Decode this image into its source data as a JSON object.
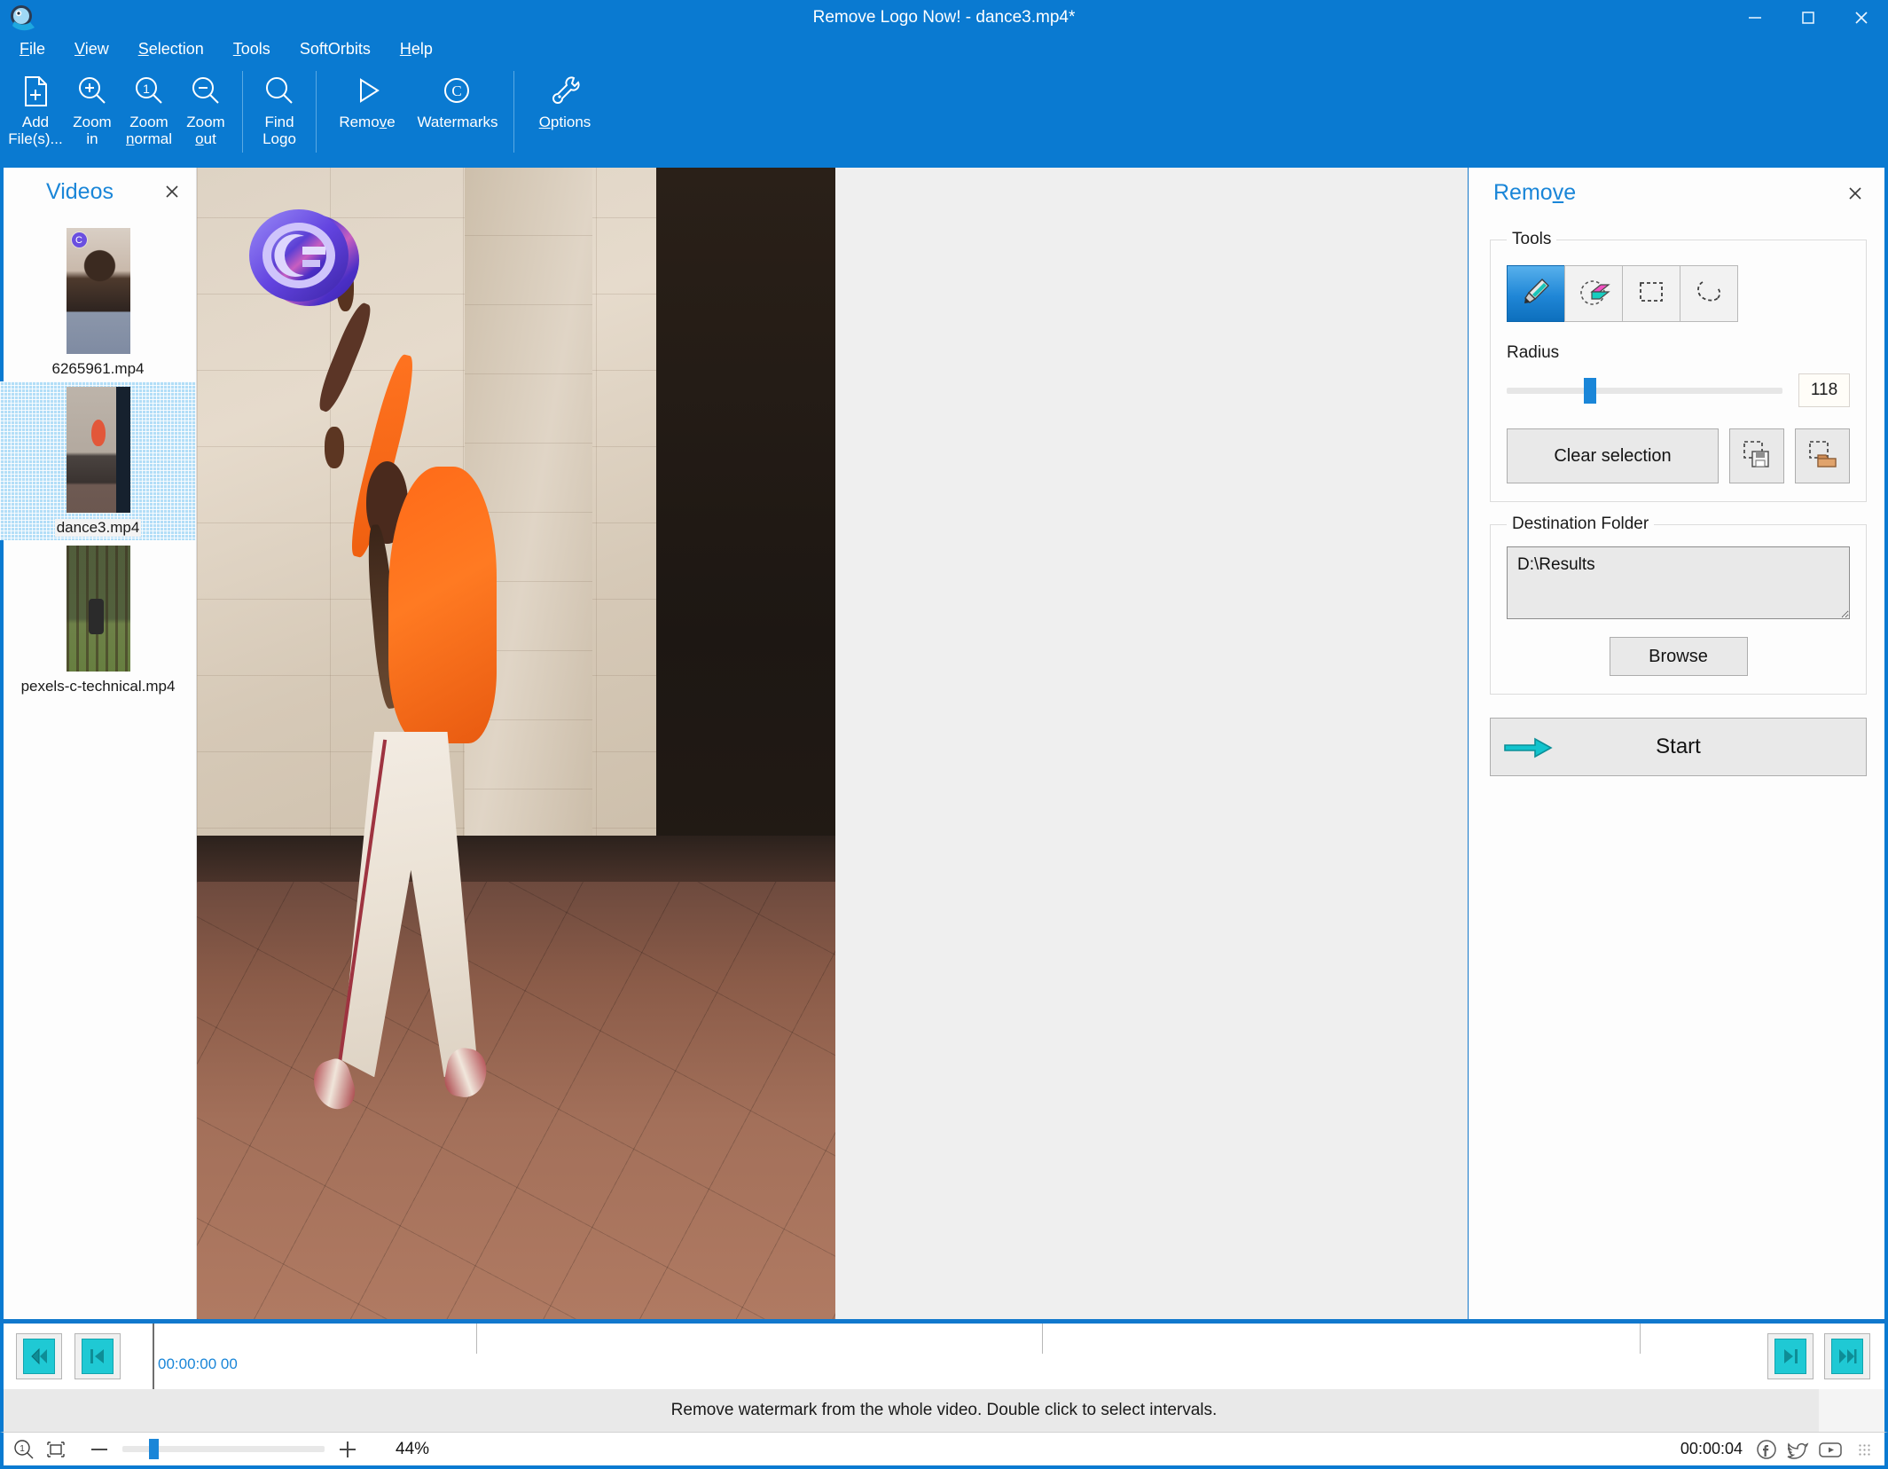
{
  "window": {
    "title": "Remove Logo Now! - dance3.mp4*",
    "app_icon": "app-logo-icon",
    "minimize": "minimize-icon",
    "maximize": "maximize-icon",
    "close": "close-icon",
    "titlebar_color": "#0a7ad1"
  },
  "menubar": {
    "items": [
      {
        "label": "File",
        "accel": "F"
      },
      {
        "label": "View",
        "accel": "V"
      },
      {
        "label": "Selection",
        "accel": "S"
      },
      {
        "label": "Tools",
        "accel": "T"
      },
      {
        "label": "SoftOrbits",
        "accel": ""
      },
      {
        "label": "Help",
        "accel": "H"
      }
    ]
  },
  "ribbon": {
    "items": [
      {
        "label_line1": "Add",
        "label_line2": "File(s)...",
        "icon": "add-file-icon"
      },
      {
        "label_line1": "Zoom",
        "label_line2": "in",
        "icon": "zoom-in-icon"
      },
      {
        "label_line1": "Zoom",
        "label_line2": "normal",
        "icon": "zoom-normal-icon"
      },
      {
        "label_line1": "Zoom",
        "label_line2": "out",
        "icon": "zoom-out-icon"
      },
      {
        "label_line1": "Find",
        "label_line2": "Logo",
        "icon": "find-logo-icon"
      },
      {
        "label_line1": "Remove",
        "label_line2": "",
        "icon": "play-triangle-icon"
      },
      {
        "label_line1": "Watermarks",
        "label_line2": "",
        "icon": "copyright-icon"
      },
      {
        "label_line1": "Options",
        "label_line2": "",
        "icon": "wrench-icon"
      }
    ]
  },
  "left_panel": {
    "title": "Videos",
    "close_icon": "close-icon",
    "items": [
      {
        "filename": "6265961.mp4",
        "selected": false,
        "thumb": "thumb-woman-confetti"
      },
      {
        "filename": "dance3.mp4",
        "selected": true,
        "thumb": "thumb-dancer-street"
      },
      {
        "filename": "pexels-c-technical.mp4",
        "selected": false,
        "thumb": "thumb-person-forest"
      }
    ]
  },
  "canvas": {
    "watermark_icon": "copyright-logo-watermark",
    "background_color": "#efefef"
  },
  "right_panel": {
    "title": "Remove",
    "title_accel": "v",
    "close_icon": "close-icon",
    "tools_group": {
      "legend": "Tools",
      "buttons": [
        {
          "name": "marker-tool",
          "icon": "marker-pen-icon",
          "active": true
        },
        {
          "name": "eraser-tool",
          "icon": "eraser-icon",
          "active": false
        },
        {
          "name": "rectangle-select-tool",
          "icon": "dashed-rectangle-icon",
          "active": false
        },
        {
          "name": "lasso-select-tool",
          "icon": "lasso-icon",
          "active": false
        }
      ],
      "radius_label": "Radius",
      "radius_value": "118",
      "radius_percent": 28,
      "clear_selection_label": "Clear selection",
      "save_selection_icon": "save-selection-icon",
      "load_selection_icon": "load-selection-icon"
    },
    "destination_group": {
      "legend": "Destination Folder",
      "path_value": "D:\\Results",
      "path_placeholder": "",
      "browse_label": "Browse"
    },
    "start_button": {
      "label": "Start",
      "icon": "arrow-right-icon",
      "accent_color": "#0db8c4"
    }
  },
  "timeline": {
    "skip_back_icon": "skip-to-start-icon",
    "step_back_icon": "step-back-icon",
    "step_forward_icon": "step-forward-icon",
    "skip_forward_icon": "skip-to-end-icon",
    "current_time": "00:00:00 00",
    "tick_positions": [
      0,
      20,
      55,
      92
    ]
  },
  "statusbar": {
    "message": "Remove watermark from the whole video. Double click to select intervals."
  },
  "bottombar": {
    "zoom_one_icon": "zoom-actual-size-icon",
    "fit_icon": "fit-to-window-icon",
    "minus_icon": "minus-icon",
    "plus_icon": "plus-icon",
    "zoom_percent_label": "44%",
    "zoom_slider_percent": 13,
    "duration": "00:00:04",
    "social": [
      {
        "name": "facebook-icon"
      },
      {
        "name": "twitter-icon"
      },
      {
        "name": "youtube-icon"
      }
    ],
    "resize_grip_icon": "resize-grip-icon"
  }
}
